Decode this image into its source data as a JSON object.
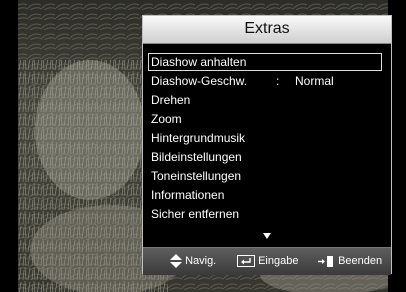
{
  "menu": {
    "title": "Extras",
    "items": [
      {
        "label": "Diashow anhalten"
      },
      {
        "label": "Diashow-Geschw.",
        "separator": ":",
        "value": "Normal"
      },
      {
        "label": "Drehen"
      },
      {
        "label": "Zoom"
      },
      {
        "label": "Hintergrundmusik"
      },
      {
        "label": "Bildeinstellungen"
      },
      {
        "label": "Toneinstellungen"
      },
      {
        "label": "Informationen"
      },
      {
        "label": "Sicher entfernen"
      }
    ],
    "selected_index": 0
  },
  "footer": {
    "navigate_label": "Navig.",
    "enter_label": "Eingabe",
    "exit_label": "Beenden"
  },
  "icons": [
    "up-down-arrows-icon",
    "enter-icon",
    "exit-icon",
    "more-down-arrow-icon"
  ],
  "colors": {
    "title_bar": "#e0e0e0",
    "panel_bg": "#000000",
    "footer_bg": "#4a4a4a",
    "text": "#ffffff"
  }
}
